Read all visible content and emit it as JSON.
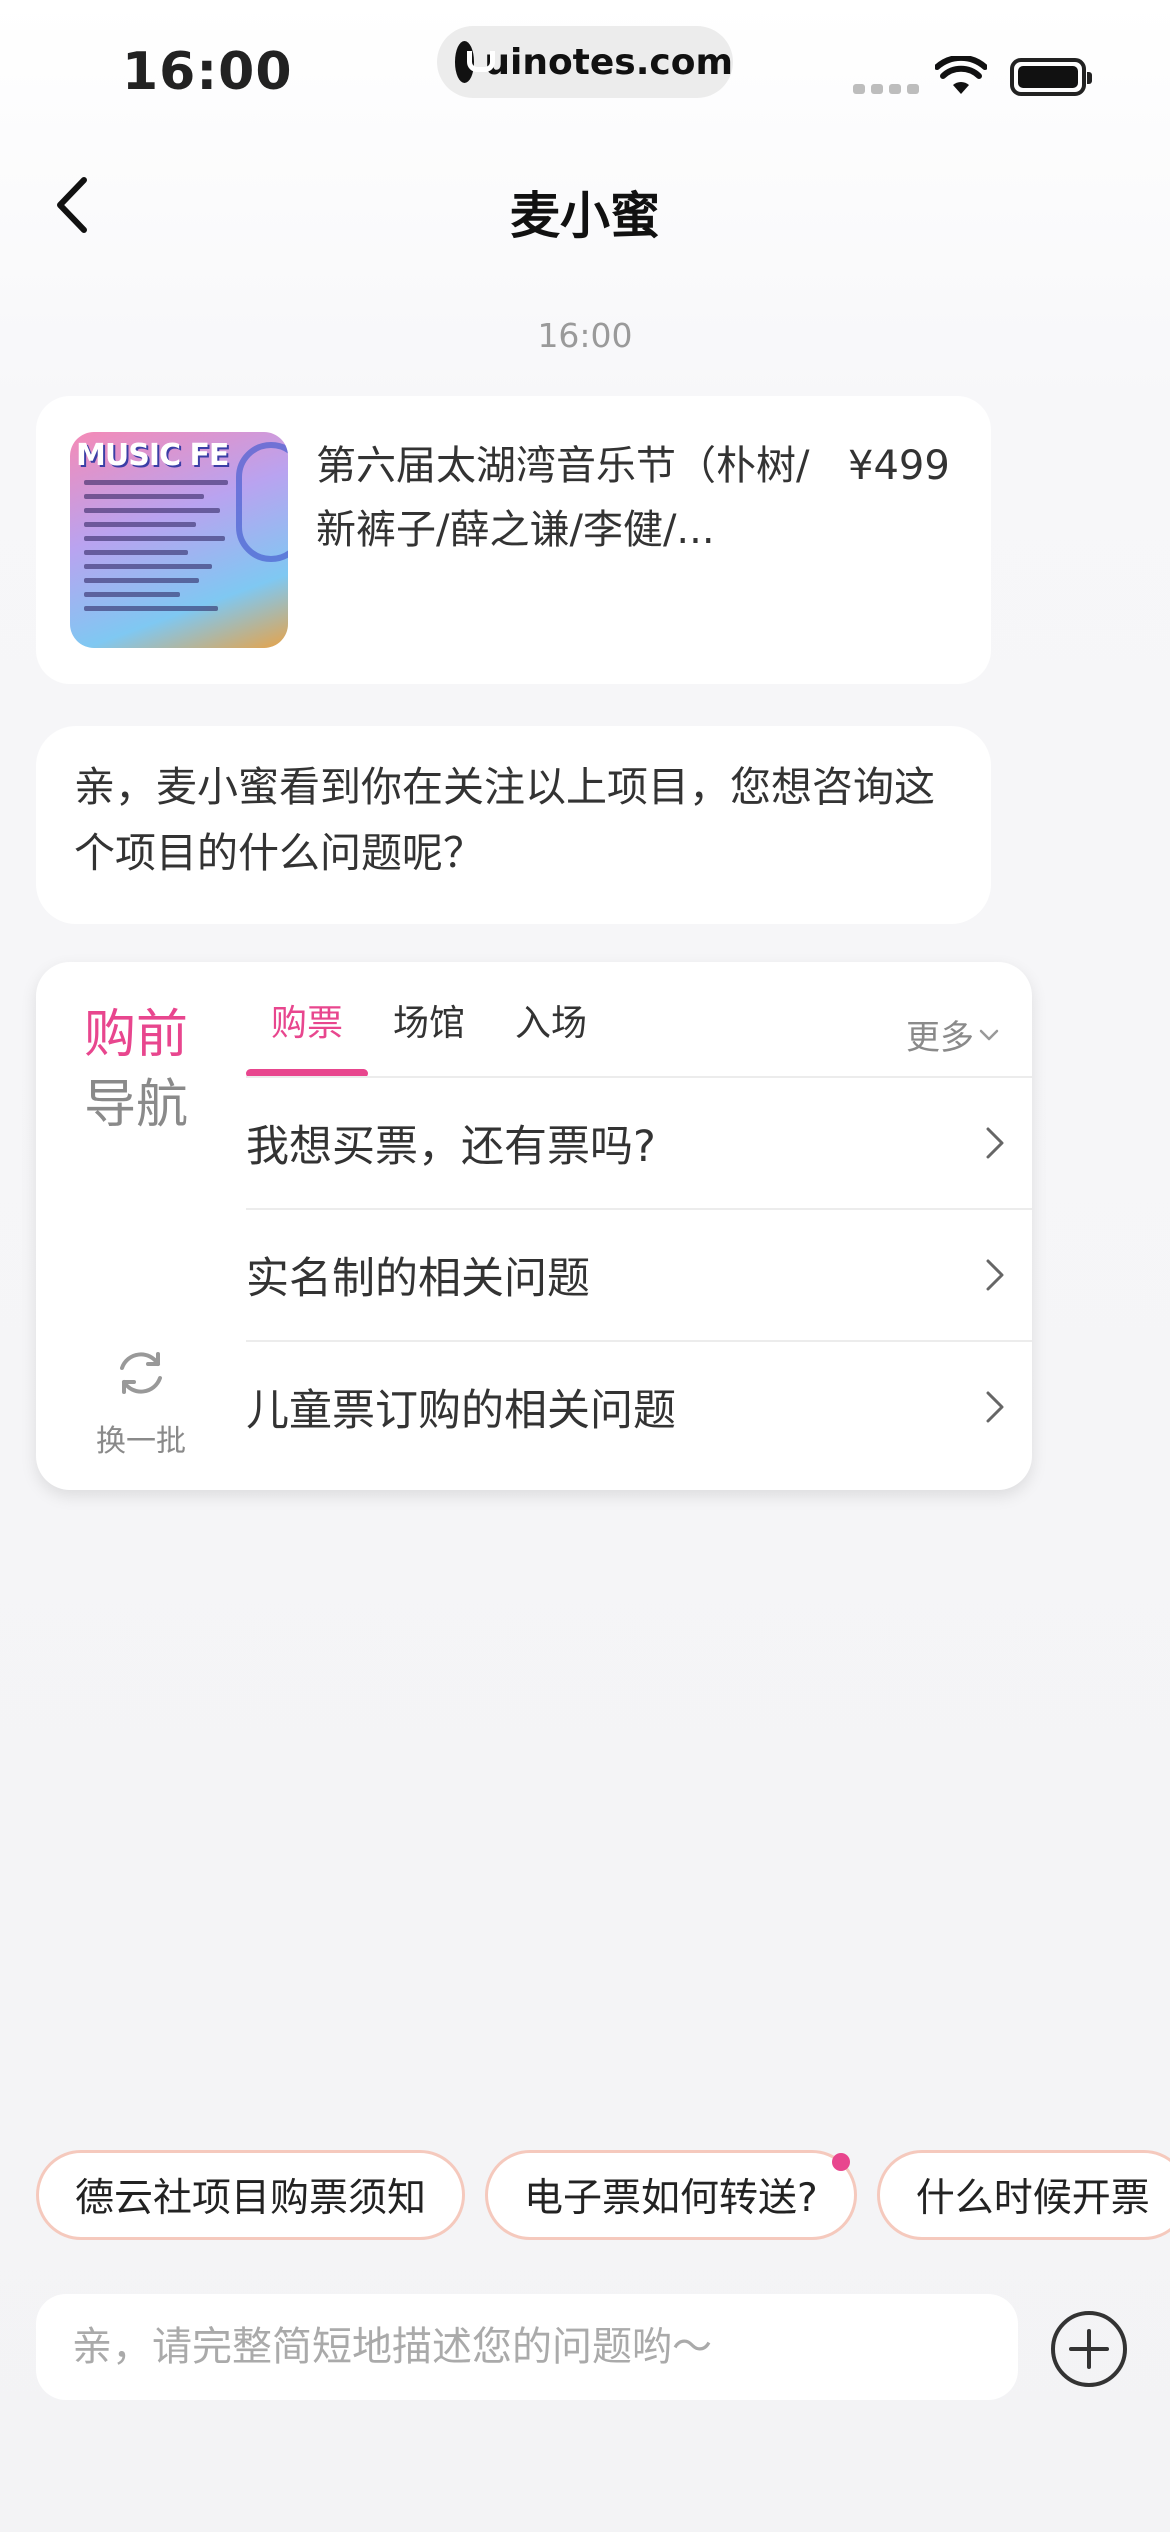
{
  "status_bar": {
    "time": "16:00",
    "url": "uinotes.com"
  },
  "nav": {
    "title": "麦小蜜"
  },
  "chat": {
    "timestamp": "16:00",
    "product": {
      "thumb_title": "MUSIC FE",
      "name": "第六届太湖湾音乐节（朴树/新裤子/薛之谦/李健/...",
      "price": "¥499"
    },
    "bot_message": "亲，麦小蜜看到你在关注以上项目，您想咨询这个项目的什么问题呢？"
  },
  "guide": {
    "title_line1": "购前",
    "title_line2": "导航",
    "tabs": [
      {
        "label": "购票",
        "active": true
      },
      {
        "label": "场馆",
        "active": false
      },
      {
        "label": "入场",
        "active": false
      }
    ],
    "more_label": "更多",
    "questions": [
      {
        "label": "我想买票，还有票吗?"
      },
      {
        "label": "实名制的相关问题"
      },
      {
        "label": "儿童票订购的相关问题"
      }
    ],
    "refresh_label": "换一批"
  },
  "quick_chips": [
    {
      "label": "德云社项目购票须知",
      "dot": false
    },
    {
      "label": "电子票如何转送?",
      "dot": true
    },
    {
      "label": "什么时候开票",
      "dot": false
    }
  ],
  "input": {
    "placeholder": "亲，请完整简短地描述您的问题哟～"
  },
  "colors": {
    "accent": "#e8468e",
    "chip_border": "#f5c9bd"
  }
}
